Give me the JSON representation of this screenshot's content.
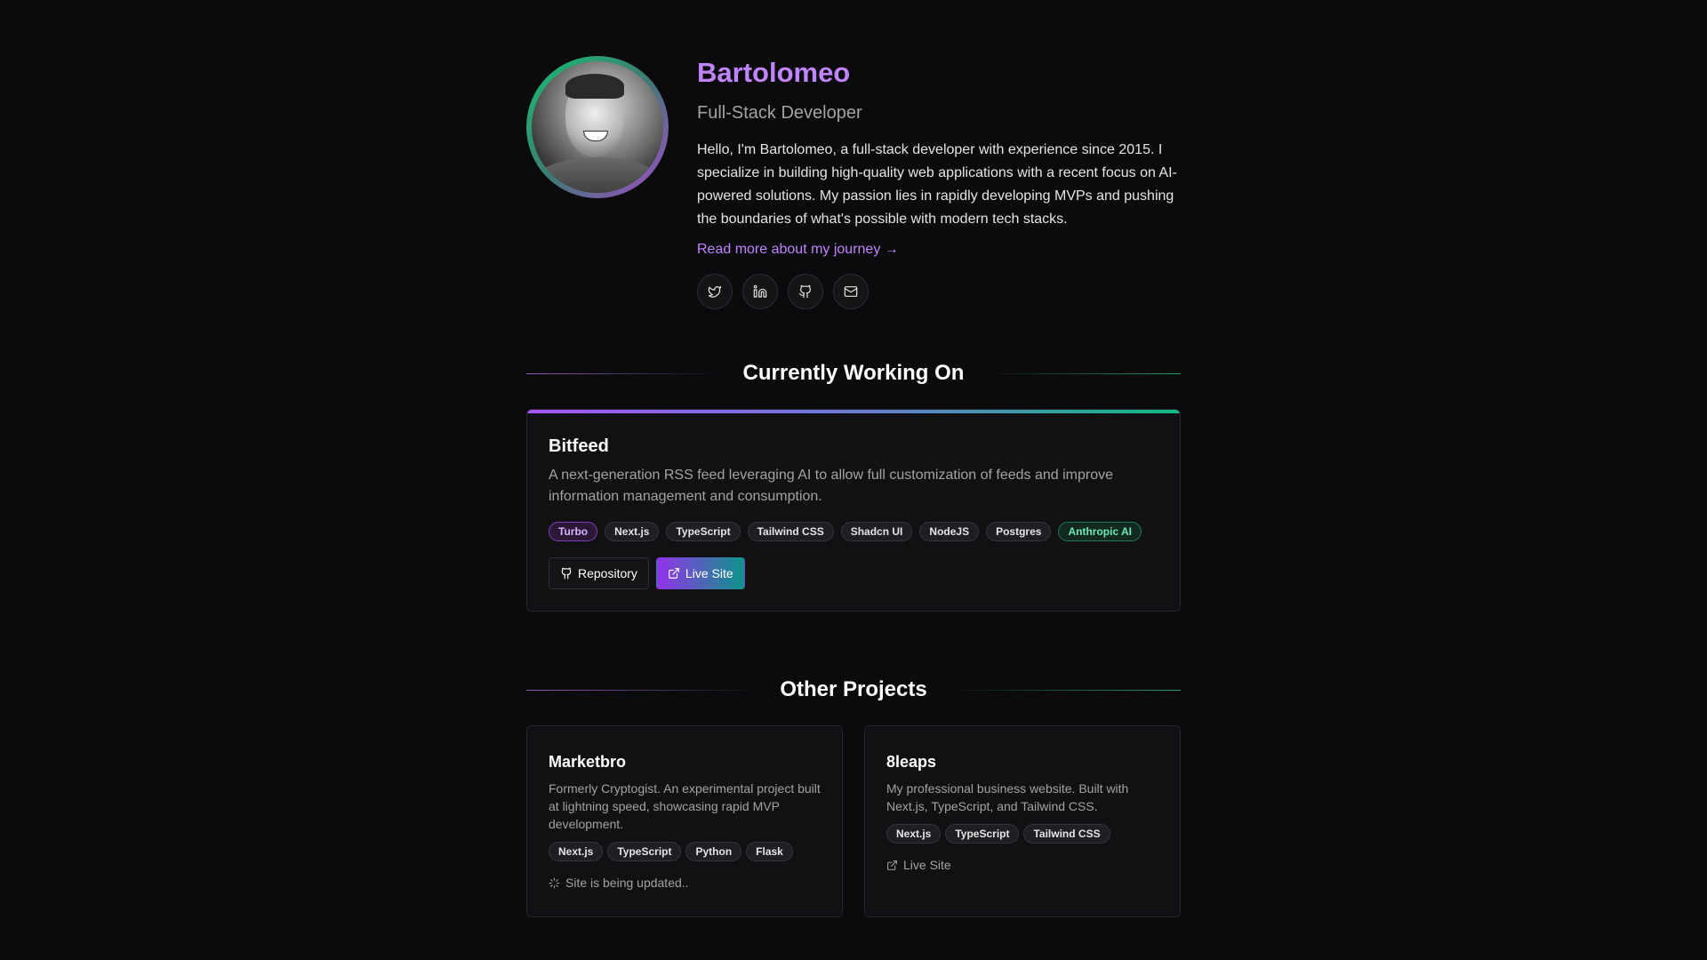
{
  "profile": {
    "name": "Bartolomeo",
    "role": "Full-Stack Developer",
    "bio": "Hello, I'm Bartolomeo, a full-stack developer with experience since 2015. I specialize in building high-quality web applications with a recent focus on AI-powered solutions. My passion lies in rapidly developing MVPs and pushing the boundaries of what's possible with modern tech stacks.",
    "read_more": "Read more about my journey →",
    "socials": [
      "twitter-icon",
      "linkedin-icon",
      "github-icon",
      "mail-icon"
    ]
  },
  "current": {
    "heading": "Currently Working On",
    "project": {
      "title": "Bitfeed",
      "description": "A next-generation RSS feed leveraging AI to allow full customization of feeds and improve information management and consumption.",
      "tags": [
        "Turbo",
        "Next.js",
        "TypeScript",
        "Tailwind CSS",
        "Shadcn UI",
        "NodeJS",
        "Postgres",
        "Anthropic AI"
      ],
      "repo_label": "Repository",
      "live_label": "Live Site"
    }
  },
  "other": {
    "heading": "Other Projects",
    "projects": [
      {
        "title": "Marketbro",
        "description": "Formerly Cryptogist. An experimental project built at lightning speed, showcasing rapid MVP development.",
        "tags": [
          "Next.js",
          "TypeScript",
          "Python",
          "Flask"
        ],
        "status": "Site is being updated.."
      },
      {
        "title": "8leaps",
        "description": "My professional business website. Built with Next.js, TypeScript, and Tailwind CSS.",
        "tags": [
          "Next.js",
          "TypeScript",
          "Tailwind CSS"
        ],
        "link": "Live Site"
      }
    ]
  },
  "colors": {
    "background": "#0b0b0d",
    "accent_purple": "#c084fc",
    "accent_green": "#10b981"
  }
}
